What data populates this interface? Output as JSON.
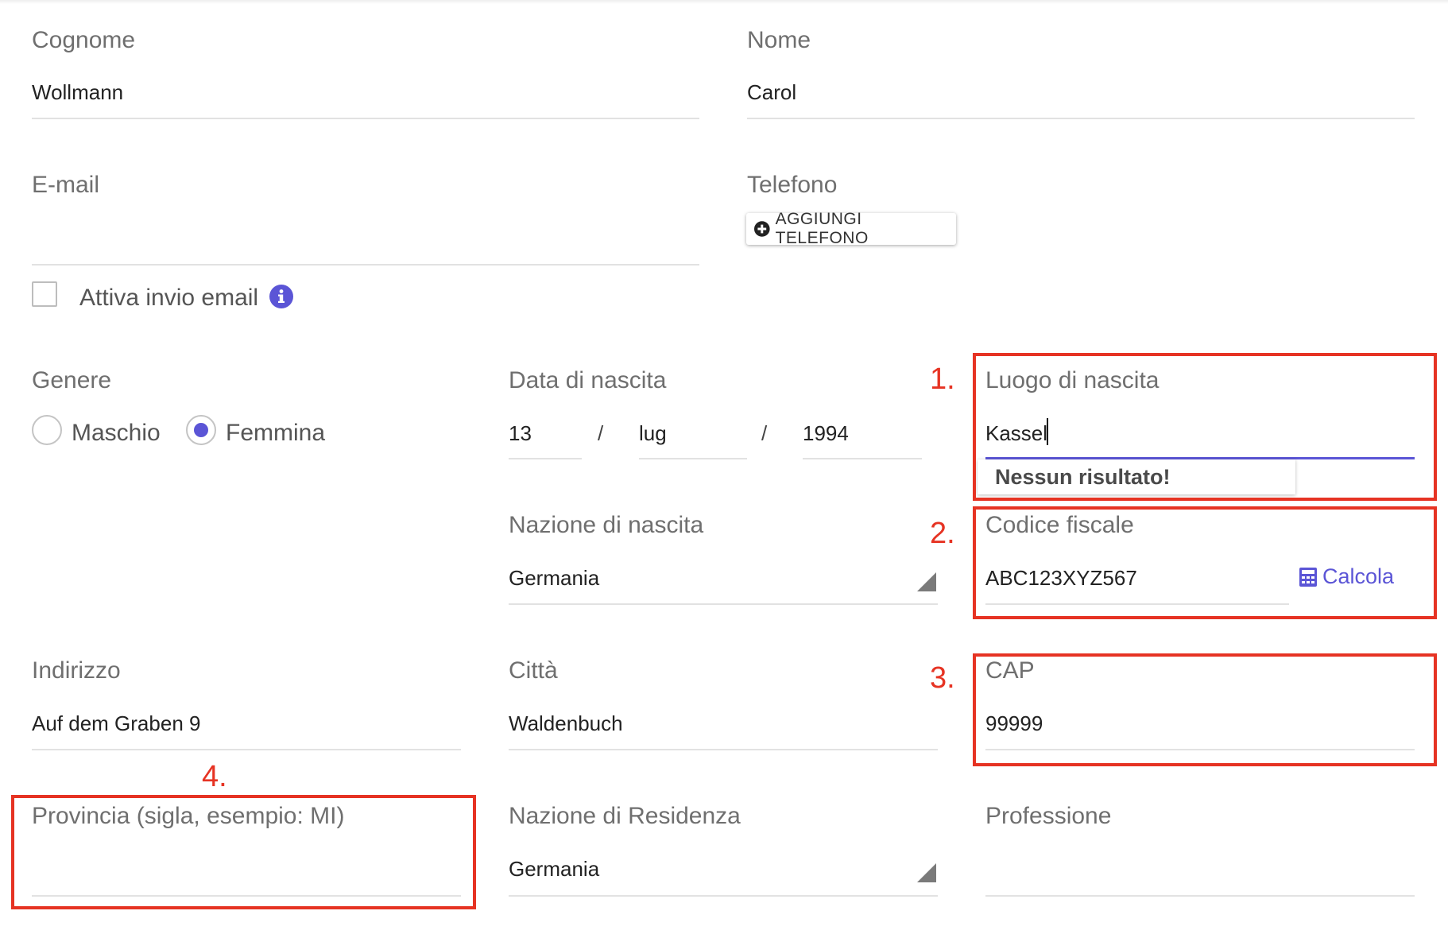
{
  "personal": {
    "surname": {
      "label": "Cognome",
      "value": "Wollmann"
    },
    "name": {
      "label": "Nome",
      "value": "Carol"
    },
    "email": {
      "label": "E-mail",
      "value": ""
    },
    "phone": {
      "label": "Telefono",
      "add_button": "AGGIUNGI TELEFONO"
    },
    "email_toggle": {
      "label": "Attiva invio email",
      "checked": false,
      "icon": "info-icon"
    }
  },
  "gender": {
    "label": "Genere",
    "options": [
      {
        "label": "Maschio",
        "selected": false
      },
      {
        "label": "Femmina",
        "selected": true
      }
    ]
  },
  "birth_date": {
    "label": "Data di nascita",
    "day": "13",
    "month": "lug",
    "year": "1994",
    "separator": "/"
  },
  "birth_place": {
    "label": "Luogo di nascita",
    "value": "Kassel",
    "no_results": "Nessun risultato!"
  },
  "birth_country": {
    "label": "Nazione di nascita",
    "value": "Germania"
  },
  "tax_code": {
    "label": "Codice fiscale",
    "value": "ABC123XYZ567",
    "calc_button": "Calcola",
    "icon": "calculator-icon"
  },
  "address": {
    "label": "Indirizzo",
    "value": "Auf dem Graben 9"
  },
  "city": {
    "label": "Città",
    "value": "Waldenbuch"
  },
  "zip": {
    "label": "CAP",
    "value": "99999"
  },
  "province": {
    "label": "Provincia (sigla, esempio: MI)",
    "value": ""
  },
  "residence_country": {
    "label": "Nazione di Residenza",
    "value": "Germania"
  },
  "profession": {
    "label": "Professione",
    "value": ""
  },
  "annotations": [
    "1.",
    "2.",
    "3.",
    "4."
  ],
  "colors": {
    "accent": "#5b55d6",
    "annotation": "#e63323",
    "label": "#6f6f6f"
  }
}
